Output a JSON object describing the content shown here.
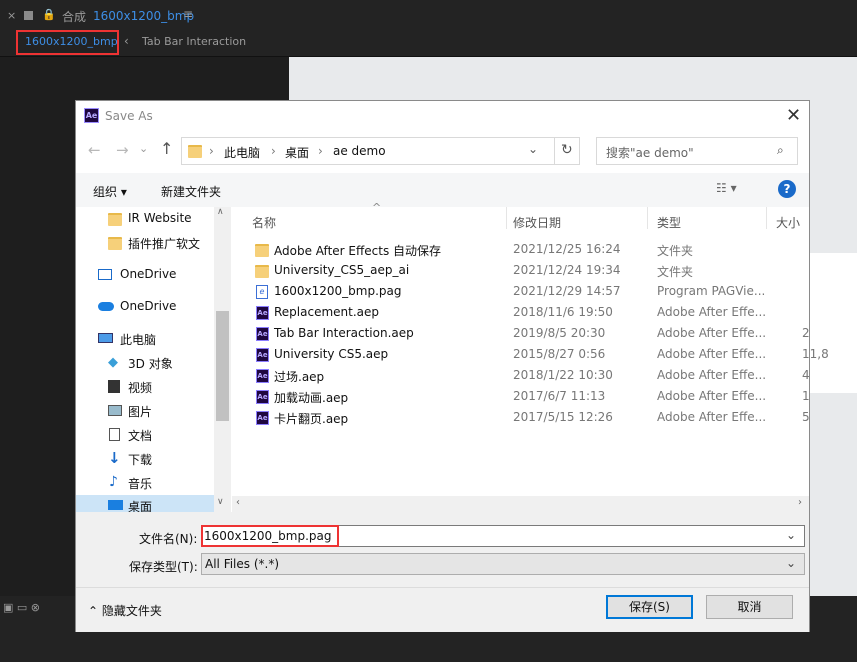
{
  "ae": {
    "comp_prefix": "合成",
    "comp_name": "1600x1200_bmp",
    "tab_active": "1600x1200_bmp",
    "tab_other": "Tab Bar Interaction"
  },
  "dialog": {
    "title": "Save As",
    "logo_text": "Ae",
    "address": {
      "crumbs": [
        "此电脑",
        "桌面",
        "ae demo"
      ],
      "search_placeholder": "搜索\"ae demo\""
    },
    "toolbar": {
      "organize": "组织",
      "new_folder": "新建文件夹"
    },
    "nav": [
      {
        "label": "IR Website",
        "icon": "folder-icon"
      },
      {
        "label": "插件推广软文",
        "icon": "folder-icon"
      },
      {
        "label": "OneDrive",
        "icon": "onedrive-icon"
      },
      {
        "label": "OneDrive",
        "icon": "onedrive-cloud-icon"
      },
      {
        "label": "此电脑",
        "icon": "computer-icon"
      },
      {
        "label": "3D 对象",
        "icon": "3d-objects-icon"
      },
      {
        "label": "视频",
        "icon": "video-icon"
      },
      {
        "label": "图片",
        "icon": "pictures-icon"
      },
      {
        "label": "文档",
        "icon": "documents-icon"
      },
      {
        "label": "下载",
        "icon": "download-icon"
      },
      {
        "label": "音乐",
        "icon": "music-icon"
      },
      {
        "label": "桌面",
        "icon": "desktop-icon"
      }
    ],
    "columns": [
      "名称",
      "修改日期",
      "类型",
      "大小"
    ],
    "files": [
      {
        "name": "Adobe After Effects 自动保存",
        "date": "2021/12/25 16:24",
        "type": "文件夹",
        "size": "",
        "icon": "folder"
      },
      {
        "name": "University_CS5_aep_ai",
        "date": "2021/12/24 19:34",
        "type": "文件夹",
        "size": "",
        "icon": "folder"
      },
      {
        "name": "1600x1200_bmp.pag",
        "date": "2021/12/29 14:57",
        "type": "Program PAGVie...",
        "size": "",
        "icon": "pag"
      },
      {
        "name": "Replacement.aep",
        "date": "2018/11/6 19:50",
        "type": "Adobe After Effe...",
        "size": "",
        "icon": "aep"
      },
      {
        "name": "Tab Bar Interaction.aep",
        "date": "2019/8/5 20:30",
        "type": "Adobe After Effe...",
        "size": "2",
        "icon": "aep"
      },
      {
        "name": "University CS5.aep",
        "date": "2015/8/27 0:56",
        "type": "Adobe After Effe...",
        "size": "11,8",
        "icon": "aep"
      },
      {
        "name": "过场.aep",
        "date": "2018/1/22 10:30",
        "type": "Adobe After Effe...",
        "size": "4",
        "icon": "aep"
      },
      {
        "name": "加载动画.aep",
        "date": "2017/6/7 11:13",
        "type": "Adobe After Effe...",
        "size": "1",
        "icon": "aep"
      },
      {
        "name": "卡片翻页.aep",
        "date": "2017/5/15 12:26",
        "type": "Adobe After Effe...",
        "size": "5",
        "icon": "aep"
      }
    ],
    "form": {
      "filename_label": "文件名(N):",
      "filename_value": "1600x1200_bmp.pag",
      "filetype_label": "保存类型(T):",
      "filetype_value": "All Files (*.*)",
      "hide_folders": "隐藏文件夹",
      "save": "保存(S)",
      "cancel": "取消"
    }
  }
}
